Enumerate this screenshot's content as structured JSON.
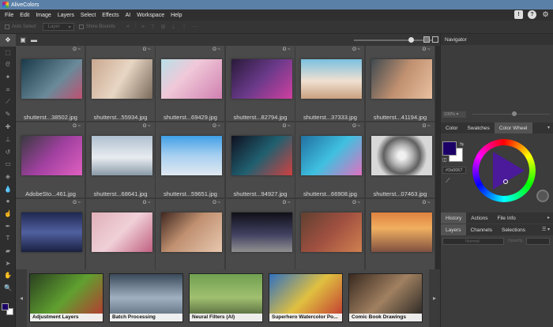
{
  "app": {
    "title": "AliveColors"
  },
  "menu": [
    "File",
    "Edit",
    "Image",
    "Layers",
    "Select",
    "Effects",
    "AI",
    "Workspace",
    "Help"
  ],
  "header_icons": [
    "message-icon",
    "help-icon",
    "gear-icon"
  ],
  "options": {
    "auto_select_label": "Auto Select",
    "layer_select_value": "Layer",
    "show_bounds_label": "Show Bounds"
  },
  "browser": {
    "files": [
      {
        "name": "shutterst...38502.jpg",
        "tag": "ʘ ~"
      },
      {
        "name": "shutterst...55934.jpg",
        "tag": "ʘ ~"
      },
      {
        "name": "shutterst...69429.jpg",
        "tag": "ʘ ~"
      },
      {
        "name": "shutterst...82794.jpg",
        "tag": "ʘ ~"
      },
      {
        "name": "shutterst...37333.jpg",
        "tag": "ʘ ~"
      },
      {
        "name": "shutterst...41194.jpg",
        "tag": "ʘ ~"
      },
      {
        "name": "AdobeSto...461.jpg",
        "tag": "ʘ ~"
      },
      {
        "name": "shutterst...68641.jpg",
        "tag": "ʘ ~"
      },
      {
        "name": "shutterst...59651.jpg",
        "tag": "ʘ ~"
      },
      {
        "name": "shutterst...94927.jpg",
        "tag": "ʘ ~"
      },
      {
        "name": "shutterst...66908.jpg",
        "tag": "ʘ ~"
      },
      {
        "name": "shutterst...07463.jpg",
        "tag": "ʘ ~"
      },
      {
        "name": "",
        "tag": "ʘ ~"
      },
      {
        "name": "",
        "tag": "ʘ ~"
      },
      {
        "name": "",
        "tag": "ʘ ~"
      },
      {
        "name": "",
        "tag": "ʘ ~"
      },
      {
        "name": "",
        "tag": "ʘ ~"
      },
      {
        "name": "",
        "tag": "ʘ ~"
      }
    ]
  },
  "filmstrip": {
    "items": [
      "Adjustment Layers",
      "Batch Processing",
      "Neural Filters (AI)",
      "Superhero Watercolor Po...",
      "Comic Book Drawings"
    ]
  },
  "navigator": {
    "title": "Navigator",
    "zoom": "100%"
  },
  "color_panel": {
    "tabs": [
      "Color",
      "Swatches",
      "Color Wheel"
    ],
    "active_tab": "Color Wheel",
    "hex": "#1b0067",
    "foreground_color": "#1b0067",
    "background_color": "#ffffff"
  },
  "history_panel": {
    "tabs": [
      "History",
      "Actions",
      "File Info"
    ]
  },
  "layers_panel": {
    "tabs": [
      "Layers",
      "Channels",
      "Selections"
    ],
    "blend_mode": "Normal",
    "opacity_label": "Opacity"
  }
}
